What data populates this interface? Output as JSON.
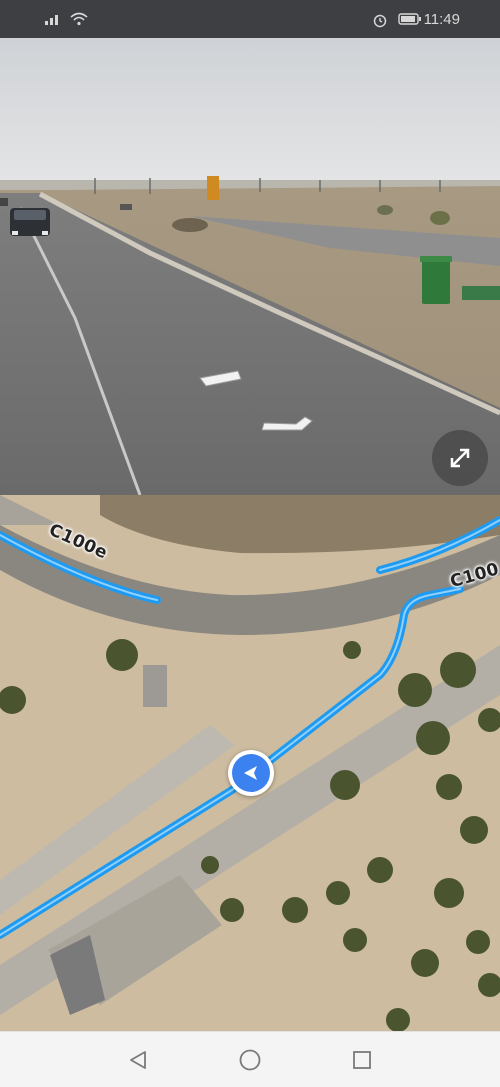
{
  "status_bar": {
    "time": "11:49",
    "left_icons": [
      "signal-icon",
      "wifi-icon"
    ],
    "right_icons": [
      "alarm-icon",
      "battery-icon"
    ]
  },
  "street_view": {
    "expand_icon": "expand-icon"
  },
  "map": {
    "road_labels": [
      "C100e",
      "C100"
    ],
    "route_color": "#1e9bf0",
    "marker_color": "#3b82f0"
  },
  "nav_bar": {
    "icons": [
      "back-icon",
      "home-icon",
      "recents-icon"
    ]
  }
}
